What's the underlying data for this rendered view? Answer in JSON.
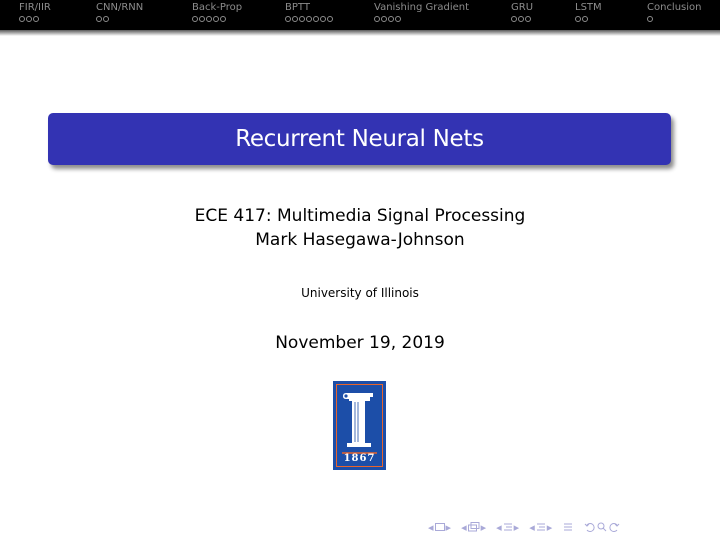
{
  "headline": {
    "sections": [
      {
        "label": "FIR/IIR",
        "frames": 3
      },
      {
        "label": "CNN/RNN",
        "frames": 2
      },
      {
        "label": "Back-Prop",
        "frames": 5
      },
      {
        "label": "BPTT",
        "frames": 7
      },
      {
        "label": "Vanishing Gradient",
        "frames": 4
      },
      {
        "label": "GRU",
        "frames": 3
      },
      {
        "label": "LSTM",
        "frames": 2
      },
      {
        "label": "Conclusion",
        "frames": 1
      }
    ]
  },
  "slide": {
    "title": "Recurrent Neural Nets",
    "subtitle": "ECE 417: Multimedia Signal Processing",
    "author": "Mark Hasegawa-Johnson",
    "institute": "University of Illinois",
    "date": "November 19, 2019",
    "logo": {
      "year": "1867",
      "name": "university-of-illinois-logo"
    }
  },
  "colors": {
    "title_bg": "#3333b3",
    "headline_bg": "#000000",
    "logo_blue": "#1c4ea8",
    "logo_orange": "#e8642c",
    "nav_symbols": "#a9a9d8"
  },
  "navigation": {
    "icons": [
      "frame-nav-icon",
      "subsection-nav-icon",
      "section-nav-icon",
      "subsection-nav-icon",
      "align-icon",
      "search-icon"
    ]
  }
}
